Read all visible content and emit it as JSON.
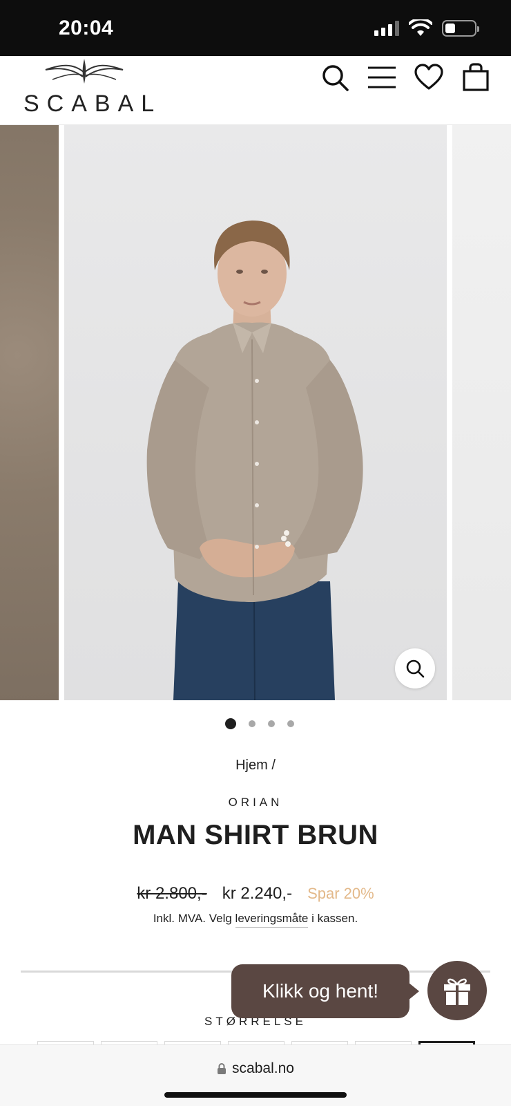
{
  "status_bar": {
    "time": "20:04",
    "signal_bars": 3,
    "signal_bars_total": 4,
    "battery_level": 0.35,
    "icons": [
      "cellular-signal-icon",
      "wifi-icon",
      "battery-icon"
    ]
  },
  "header": {
    "logo_text": "SCABAL",
    "icons": [
      "search-icon",
      "menu-icon",
      "heart-icon",
      "shopping-bag-icon"
    ]
  },
  "gallery": {
    "slide_count": 4,
    "active_slide": 1,
    "zoom_icon": "zoom-icon",
    "main_image": "man-in-beige-shirt-photo"
  },
  "product": {
    "breadcrumb": "Hjem /",
    "vendor": "ORIAN",
    "title": "MAN SHIRT BRUN",
    "price_old": "kr 2.800,-",
    "price_new": "kr 2.240,-",
    "savings": "Spar 20%",
    "tax_note_prefix": "Inkl. MVA. Velg ",
    "tax_note_link": "leveringsmåte",
    "tax_note_suffix": " i kassen.",
    "size_label": "STØRRELSE",
    "size_option_count": 7,
    "selected_size_index": 6
  },
  "promo": {
    "label": "Klikk og hent!",
    "icon": "gift-icon"
  },
  "browser": {
    "url": "scabal.no",
    "lock_icon": "lock-icon"
  },
  "colors": {
    "promo_bg": "#5a4742",
    "savings": "#e3b98a",
    "text": "#1f1f1f"
  }
}
